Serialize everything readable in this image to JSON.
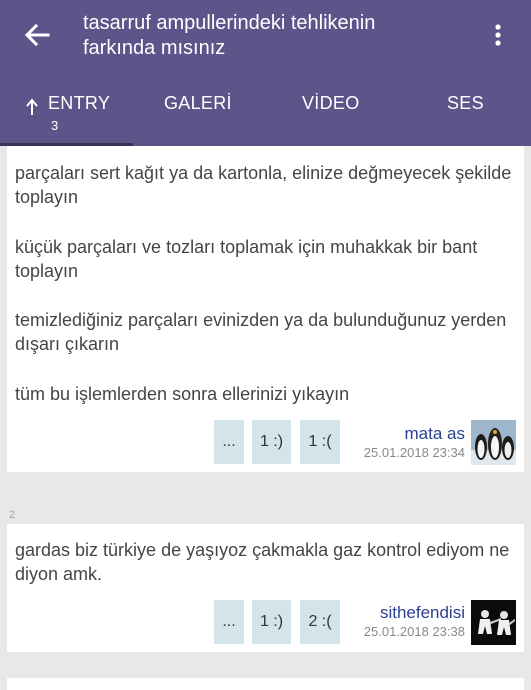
{
  "header": {
    "title": "tasarruf ampullerindeki tehlikenin farkında mısınız",
    "title_line1": "tasarruf ampullerindeki tehlikenin",
    "title_line2": "farkında mısınız",
    "back_icon": "arrow-left-icon",
    "menu_icon": "more-vertical-icon",
    "background_color": "#5f548a"
  },
  "tabs": [
    {
      "label": "ENTRY",
      "badge": "3",
      "icon": "arrow-up-icon",
      "active": true
    },
    {
      "label": "GALERİ"
    },
    {
      "label": "VİDEO"
    },
    {
      "label": "SES"
    }
  ],
  "entries": [
    {
      "paragraphs": [
        "parçaları sert kağıt ya da kartonla, elinize değmeyecek şekilde toplayın",
        "küçük parçaları ve tozları toplamak için muhakkak bir bant toplayın",
        "temizlediğiniz parçaları evinizden ya da bulunduğunuz yerden dışarı çıkarın",
        "tüm bu işlemlerden sonra ellerinizi yıkayın"
      ],
      "actions": {
        "more": "...",
        "likes": "1 :)",
        "dislikes": "1 :("
      },
      "author": "mata as",
      "date": "25.01.2018 23:34",
      "avatar_icon": "penguins-avatar"
    },
    {
      "number": "2",
      "paragraphs": [
        "gardas biz türkiye de yaşıyoz çakmakla gaz kontrol ediyom ne diyon amk."
      ],
      "actions": {
        "more": "...",
        "likes": "1 :)",
        "dislikes": "2 :("
      },
      "author": "sithefendisi",
      "date": "25.01.2018 23:38",
      "avatar_icon": "pulp-fiction-avatar"
    }
  ],
  "colors": {
    "primary": "#5f548a",
    "tab_indicator": "#3b3355",
    "action_button": "#d3e5ea",
    "author_link": "#2a3f8f",
    "background": "#e8e8e8"
  }
}
